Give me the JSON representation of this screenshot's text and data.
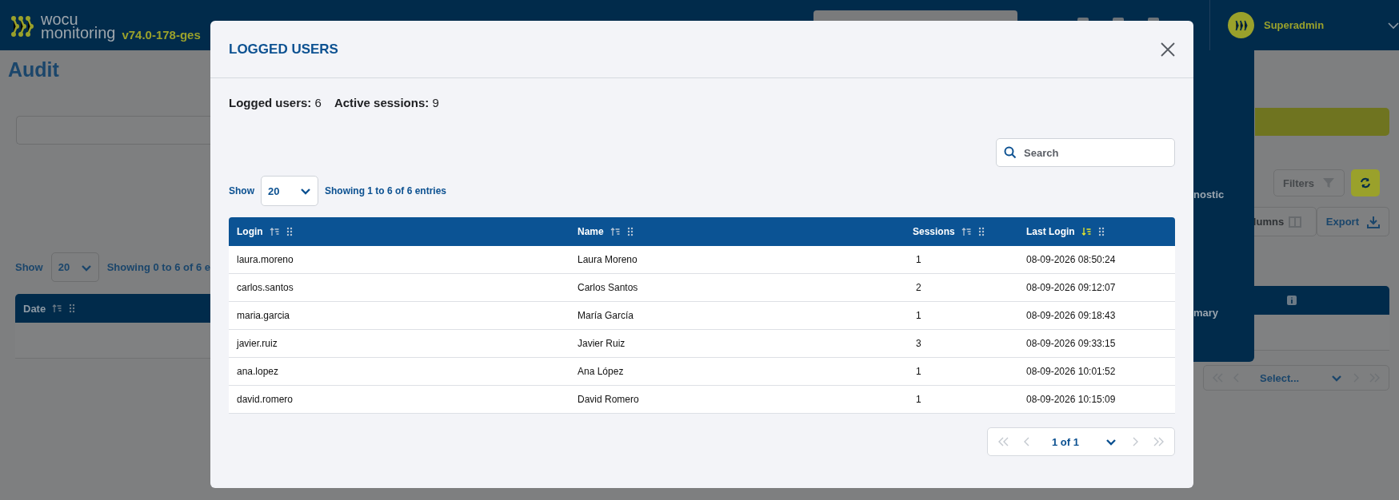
{
  "background": {
    "header": {
      "logo_lines": [
        "wocu",
        "monitoring"
      ],
      "version": "v74.0-178-ges",
      "user": "Superadmin"
    },
    "page_title": "Audit",
    "show_label": "Show",
    "page_size": "20",
    "entries_info": "Showing 0 to 6 of 6 e",
    "table_columns": [
      {
        "label": "Date"
      }
    ],
    "side_menu": [
      "nostic",
      "mary"
    ],
    "buttons": [
      {
        "kind": "filters",
        "label": "Filters"
      },
      {
        "kind": "refresh"
      },
      {
        "kind": "columns",
        "label": "lumns"
      },
      {
        "kind": "export",
        "label": "Export"
      }
    ],
    "pagination": {
      "placeholder": "Select..."
    }
  },
  "modal": {
    "title": "LOGGED USERS",
    "summary": [
      "**Logged users:** 6",
      "**Active sessions:** 9"
    ],
    "search": {
      "placeholder": "Search"
    },
    "show_label": "Show",
    "page_size": "20",
    "entries_info": "Showing 1 to 6 of 6 entries",
    "columns": [
      {
        "label": "Login",
        "sorted": false
      },
      {
        "label": "Name",
        "sorted": false
      },
      {
        "label": "Sessions",
        "sorted": false
      },
      {
        "label": "Last Login",
        "sorted": true
      }
    ],
    "rows": [
      {
        "cells": [
          "laura.moreno",
          "Laura Moreno",
          "1",
          "08-09-2026 08:50:24"
        ]
      },
      {
        "cells": [
          "carlos.santos",
          "Carlos Santos",
          "2",
          "08-09-2026 09:12:07"
        ]
      },
      {
        "cells": [
          "maria.garcia",
          "María García",
          "1",
          "08-09-2026 09:18:43"
        ]
      },
      {
        "cells": [
          "javier.ruiz",
          "Javier Ruiz",
          "3",
          "08-09-2026 09:33:15"
        ]
      },
      {
        "cells": [
          "ana.lopez",
          "Ana López",
          "1",
          "08-09-2026 10:01:52"
        ]
      },
      {
        "cells": [
          "david.romero",
          "David Romero",
          "1",
          "08-09-2026 10:15:09"
        ]
      }
    ],
    "pagination": {
      "page": "1 of 1",
      "controls": [
        {
          "kind": "first",
          "disabled": true
        },
        {
          "kind": "prev",
          "disabled": true
        },
        {
          "kind": "next",
          "disabled": true
        },
        {
          "kind": "last",
          "disabled": true
        }
      ]
    }
  }
}
